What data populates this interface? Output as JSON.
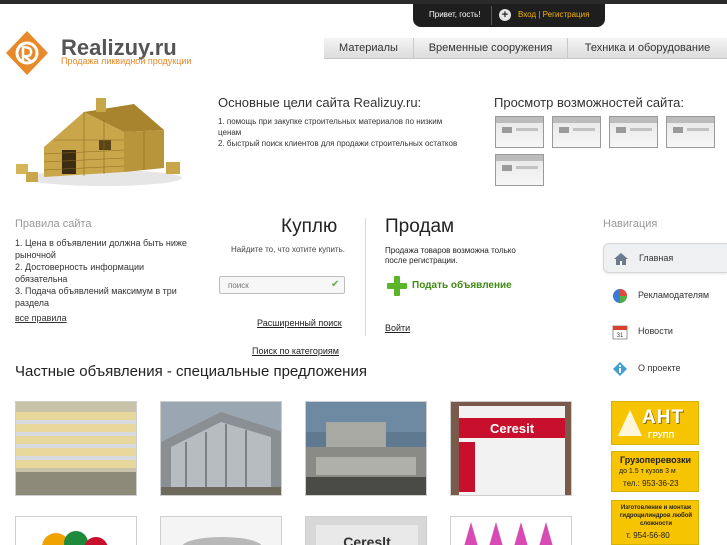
{
  "userbar": {
    "greeting": "Привет, гость!",
    "login": "Вход",
    "divider": "|",
    "register": "Регистрация"
  },
  "logo": {
    "title": "Realizuy.ru",
    "subtitle": "Продажа ликвидной продукции"
  },
  "topnav": [
    "Материалы",
    "Временные сооружения",
    "Техника и оборудование"
  ],
  "goals": {
    "title": "Основные цели сайта Realizuy.ru:",
    "items": [
      "1. помощь при закупке строительных материалов по низким ценам",
      "2. быстрый поиск клиентов для продажи строительных остатков"
    ]
  },
  "preview": {
    "title": "Просмотр возможностей сайта:"
  },
  "rules": {
    "title": "Правила сайта",
    "items": [
      "1. Цена в объявлении должна быть ниже рыночной",
      "2. Достоверность информации обязательна",
      "3. Подача объявлений максимум в три раздела"
    ],
    "all_link": "все правила"
  },
  "buy": {
    "title": "Куплю",
    "hint": "Найдите то, что хотите купить.",
    "search_placeholder": "поиск",
    "advanced_link": "Расширенный поиск",
    "category_link": "Поиск по категориям"
  },
  "sell": {
    "title": "Продам",
    "hint_prefix": "Продажа товаров возможна только после ",
    "hint_link": "регистрации",
    "hint_suffix": ".",
    "add_button": "Подать объявление",
    "login_link": "Войти"
  },
  "navigation": {
    "title": "Навигация",
    "items": [
      {
        "label": "Главная",
        "icon": "home-icon"
      },
      {
        "label": "Рекламодателям",
        "icon": "pie-chart-icon"
      },
      {
        "label": "Новости",
        "icon": "calendar-icon"
      },
      {
        "label": "О проекте",
        "icon": "info-icon"
      }
    ]
  },
  "section_title": "Частные объявления - специальные предложения",
  "ads": {
    "ad1_big": "АНТ",
    "ad1_small": "ГРУПП",
    "ad2_title": "Грузоперевозки",
    "ad2_line": "до 1.5 т  кузов 3 м",
    "ad2_phone": "тел.: 953-36-23",
    "ad3_title": "Изготовление и монтаж гидроцилиндров любой сложности",
    "ad3_phone": "т. 954-56-80"
  },
  "product_labels": {
    "ceresit1": "Ceresit",
    "ceresit2": "Cereslt"
  },
  "colors": {
    "accent_orange": "#e8892a",
    "userbar_link": "#f5b301",
    "add_green": "#3f8a12",
    "ad_yellow": "#f6c400"
  }
}
